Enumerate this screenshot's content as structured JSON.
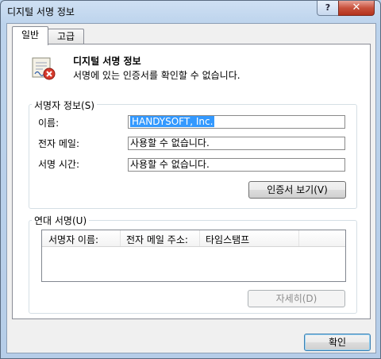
{
  "window": {
    "title": "디지털 서명 정보",
    "help_label": "?",
    "close_label": "✕"
  },
  "tabs": [
    {
      "label": "일반"
    },
    {
      "label": "고급"
    }
  ],
  "header": {
    "title": "디지털 서명 정보",
    "description": "서명에 있는 인증서를 확인할 수 없습니다."
  },
  "signer_info": {
    "group_label": "서명자 정보(S)",
    "name_label": "이름:",
    "name_value": "HANDYSOFT, Inc.",
    "email_label": "전자 메일:",
    "email_value": "사용할 수 없습니다.",
    "time_label": "서명 시간:",
    "time_value": "사용할 수 없습니다.",
    "view_cert_button": "인증서 보기(V)"
  },
  "countersignatures": {
    "group_label": "연대 서명(U)",
    "columns": [
      "서명자 이름:",
      "전자 메일 주소:",
      "타임스탬프"
    ],
    "details_button": "자세히(D)"
  },
  "footer": {
    "ok_button": "확인"
  }
}
